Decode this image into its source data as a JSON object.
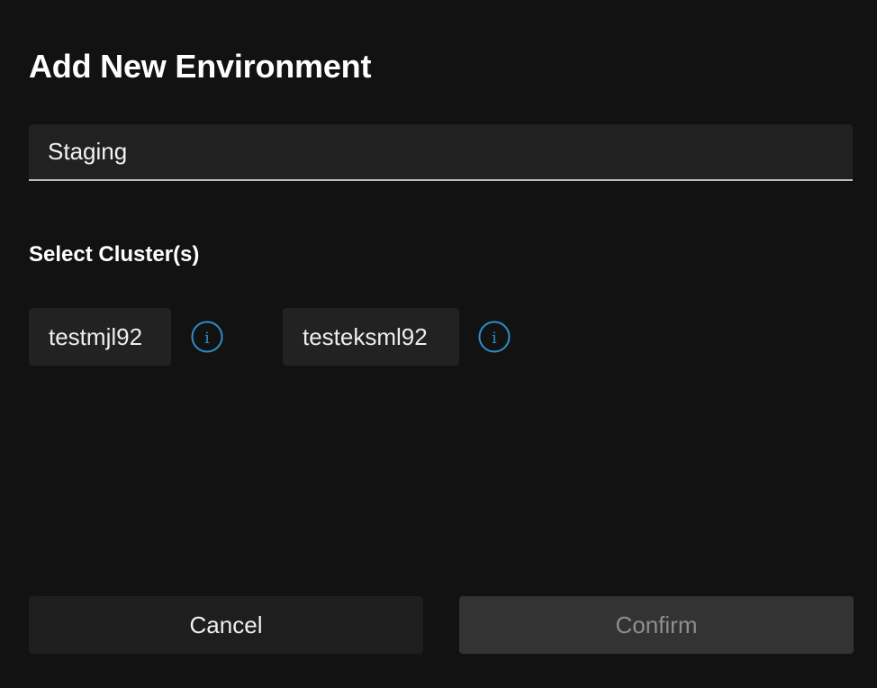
{
  "dialog": {
    "title": "Add New Environment",
    "name_input": {
      "value": "Staging",
      "placeholder": ""
    },
    "section_label": "Select Cluster(s)",
    "clusters": [
      {
        "label": "testmjl92",
        "icon": "info-icon"
      },
      {
        "label": "testeksml92",
        "icon": "info-icon"
      }
    ],
    "buttons": {
      "cancel_label": "Cancel",
      "confirm_label": "Confirm"
    }
  },
  "colors": {
    "background": "#121212",
    "field_background": "#212121",
    "chip_background": "#222222",
    "info_icon": "#2d8fc9",
    "confirm_disabled_text": "#8e8e8e"
  }
}
